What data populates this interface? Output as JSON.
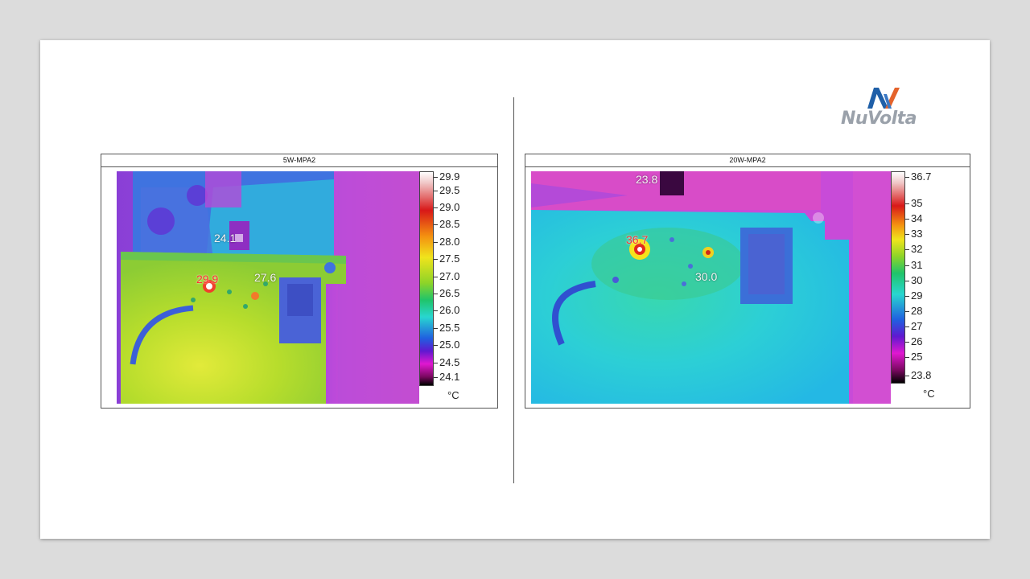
{
  "logo": {
    "text": "NuVolta"
  },
  "left_panel": {
    "title": "5W-MPA2",
    "scale": [
      "29.9",
      "29.5",
      "29.0",
      "28.5",
      "28.0",
      "27.5",
      "27.0",
      "26.5",
      "26.0",
      "25.5",
      "25.0",
      "24.5",
      "24.1"
    ],
    "unit": "°C",
    "markers": {
      "min": "24.1",
      "max": "29.9",
      "spot": "27.6"
    }
  },
  "right_panel": {
    "title": "20W-MPA2",
    "scale": [
      "36.7",
      "35",
      "34",
      "33",
      "32",
      "31",
      "30",
      "29",
      "28",
      "27",
      "26",
      "25",
      "23.8"
    ],
    "unit": "°C",
    "markers": {
      "min": "23.8",
      "max": "36.7",
      "spot": "30.0"
    }
  }
}
